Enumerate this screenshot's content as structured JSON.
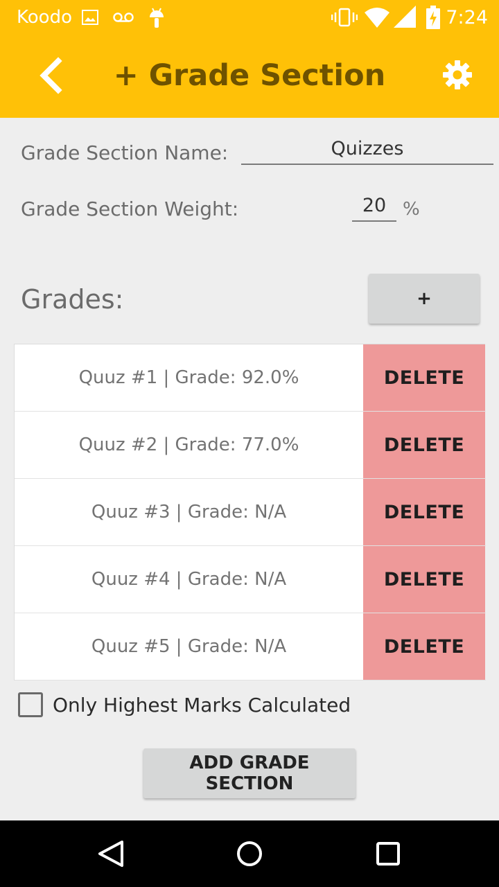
{
  "status_bar": {
    "carrier": "Koodo",
    "time": "7:24",
    "icons": [
      "image-icon",
      "voicemail-icon",
      "android-icon",
      "vibrate-icon",
      "wifi-icon",
      "signal-icon",
      "battery-charging-icon"
    ]
  },
  "toolbar": {
    "title": "+ Grade Section",
    "back_icon": "chevron-left-icon",
    "settings_icon": "gear-icon"
  },
  "form": {
    "name_label": "Grade Section Name:",
    "name_value": "Quizzes",
    "weight_label": "Grade Section Weight:",
    "weight_value": "20",
    "weight_unit": "%"
  },
  "grades": {
    "label": "Grades:",
    "add_label": "+",
    "delete_label": "DELETE",
    "items": [
      {
        "text": "Quuz #1 | Grade: 92.0%"
      },
      {
        "text": "Quuz #2 | Grade: 77.0%"
      },
      {
        "text": "Quuz #3 | Grade: N/A"
      },
      {
        "text": "Quuz #4 | Grade: N/A"
      },
      {
        "text": "Quuz #5 | Grade: N/A"
      }
    ]
  },
  "options": {
    "highest_marks_label": "Only Highest Marks Calculated",
    "highest_marks_checked": false
  },
  "actions": {
    "add_section_label": "ADD GRADE SECTION"
  },
  "nav": {
    "icons": [
      "back-triangle-icon",
      "home-circle-icon",
      "recents-square-icon"
    ]
  },
  "colors": {
    "toolbar": "#ffc107",
    "title": "#6e5200",
    "delete": "#ee9999",
    "button": "#d6d7d7",
    "background": "#eeeeee"
  }
}
